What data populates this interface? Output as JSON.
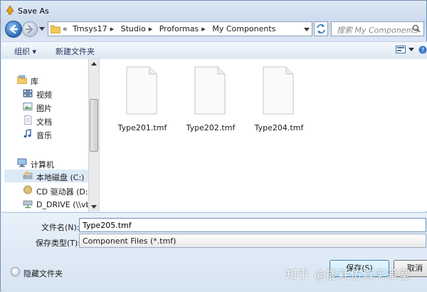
{
  "window": {
    "title": "Save As"
  },
  "address": {
    "overflow": "«",
    "crumbs": [
      "Trnsys17",
      "Studio",
      "Proformas",
      "My Components"
    ]
  },
  "search": {
    "placeholder": "搜索 My Components"
  },
  "toolbar": {
    "organize": "组织 ▾",
    "new_folder": "新建文件夹"
  },
  "nav": {
    "libraries": "库",
    "videos": "视频",
    "pictures": "图片",
    "documents": "文档",
    "music": "音乐",
    "computer": "计算机",
    "local_disk": "本地磁盘 (C:)",
    "cd_drive": "CD 驱动器 (D:) \\",
    "d_drive": "D_DRIVE (\\\\vbo"
  },
  "files": [
    "Type201.tmf",
    "Type202.tmf",
    "Type204.tmf"
  ],
  "form": {
    "filename_label": "文件名(N):",
    "filename_value": "Type205.tmf",
    "type_label": "保存类型(T):",
    "type_value": "Component Files (*.tmf)"
  },
  "footer": {
    "hide_folders": "隐藏文件夹",
    "save": "保存(S)",
    "cancel": "取消"
  },
  "watermark": "知乎 @能耗仿真实验室"
}
